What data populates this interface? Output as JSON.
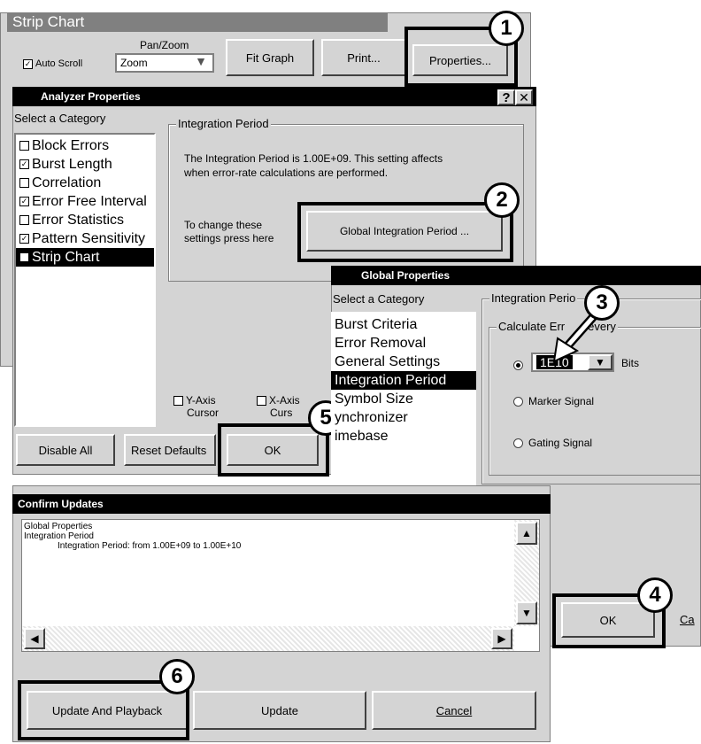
{
  "strip_chart": {
    "title": "Strip Chart",
    "auto_scroll_label": "Auto Scroll",
    "auto_scroll_checked": true,
    "pan_zoom_label": "Pan/Zoom",
    "pan_zoom_value": "Zoom",
    "fit_graph_label": "Fit Graph",
    "print_label": "Print...",
    "properties_label": "Properties..."
  },
  "analyzer": {
    "title": "Analyzer Properties",
    "help_label": "?",
    "close_label": "✕",
    "select_category_label": "Select a Category",
    "categories": [
      {
        "label": "Block Errors",
        "checked": false
      },
      {
        "label": "Burst Length",
        "checked": true
      },
      {
        "label": "Correlation",
        "checked": false
      },
      {
        "label": "Error Free Interval",
        "checked": true
      },
      {
        "label": "Error Statistics",
        "checked": false
      },
      {
        "label": "Pattern Sensitivity",
        "checked": true
      },
      {
        "label": "Strip Chart",
        "checked": true,
        "selected": true
      }
    ],
    "group_label": "Integration Period",
    "info_line1": "The Integration Period is 1.00E+09. This setting affects",
    "info_line2": "when error-rate calculations are performed.",
    "change_line1": "To change these",
    "change_line2": "settings press here",
    "global_button": "Global Integration Period ...",
    "y_axis_line1": "Y-Axis",
    "y_axis_line2": "Cursor",
    "x_axis_line1": "X-Axis",
    "x_axis_line2": "Curs",
    "disable_all": "Disable All",
    "reset_defaults": "Reset Defaults",
    "ok": "OK"
  },
  "global": {
    "title": "Global Properties",
    "select_category_label": "Select a Category",
    "categories": [
      "Burst Criteria",
      "Error Removal",
      "General Settings",
      "Integration Period",
      "Symbol Size",
      "ynchronizer",
      "imebase"
    ],
    "selected_index": 3,
    "group_label": "Integration Perio",
    "sub_group_label": "Calculate Err",
    "sub_group_label_tail": "every",
    "value": "1E10",
    "bits_label": "Bits",
    "marker_signal": "Marker Signal",
    "gating_signal": "Gating Signal",
    "ok": "OK",
    "cancel_partial": "Ca"
  },
  "confirm": {
    "title": "Confirm Updates",
    "line1": "Global Properties",
    "line2": "Integration Period",
    "line3": "Integration Period: from 1.00E+09 to 1.00E+10",
    "update_and_playback": "Update And Playback",
    "update": "Update",
    "cancel": "Cancel"
  },
  "callouts": [
    "1",
    "2",
    "3",
    "4",
    "5",
    "6"
  ]
}
